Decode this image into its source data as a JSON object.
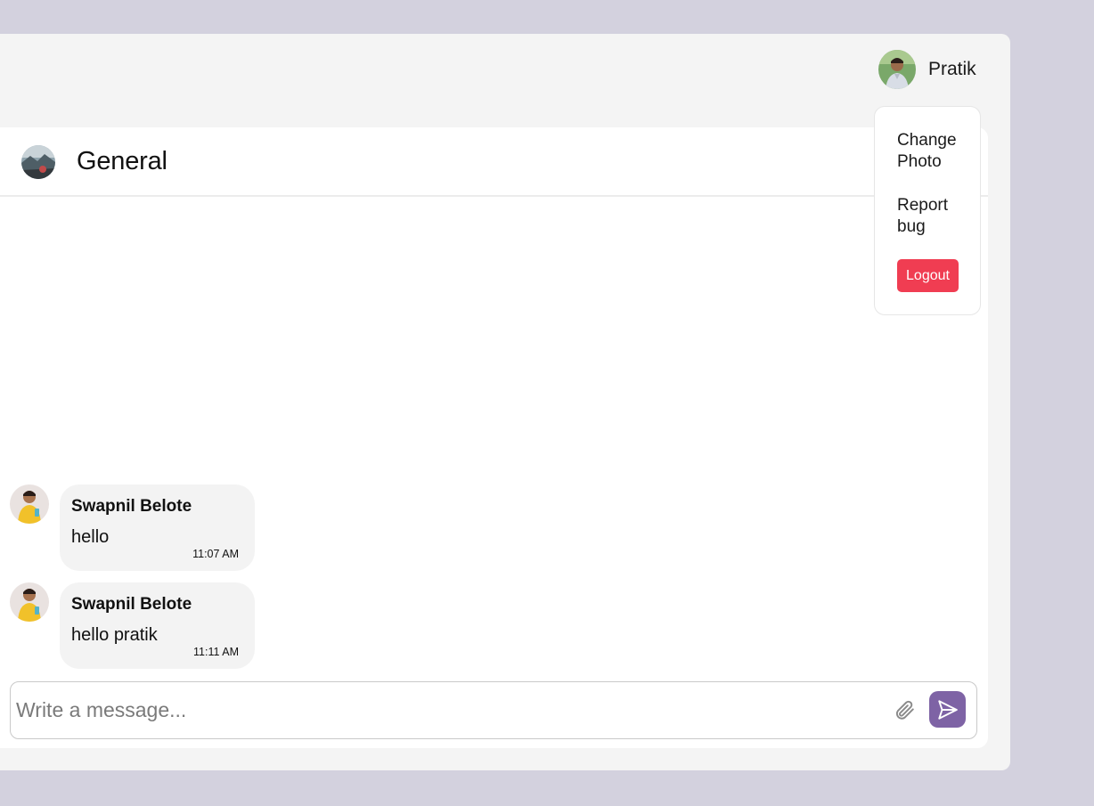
{
  "user": {
    "name": "Pratik",
    "avatar_icon": "user-photo"
  },
  "dropdown": {
    "change_photo": "Change Photo",
    "report_bug": "Report bug",
    "logout": "Logout",
    "logout_color": "#f03d52"
  },
  "chat": {
    "room_title": "General",
    "room_avatar_icon": "room-photo",
    "messages": [
      {
        "sender": "Swapnil Belote",
        "text": "hello",
        "time": "11:07 AM"
      },
      {
        "sender": "Swapnil Belote",
        "text": "hello pratik",
        "time": "11:11 AM"
      }
    ]
  },
  "composer": {
    "placeholder": "Write a message...",
    "value": "",
    "attach_icon": "paperclip-icon",
    "send_icon": "send-icon",
    "send_color": "#7e63a5"
  },
  "colors": {
    "page_background": "#d3d1de",
    "window_background": "#f4f4f4",
    "bubble_background": "#f3f3f3"
  }
}
